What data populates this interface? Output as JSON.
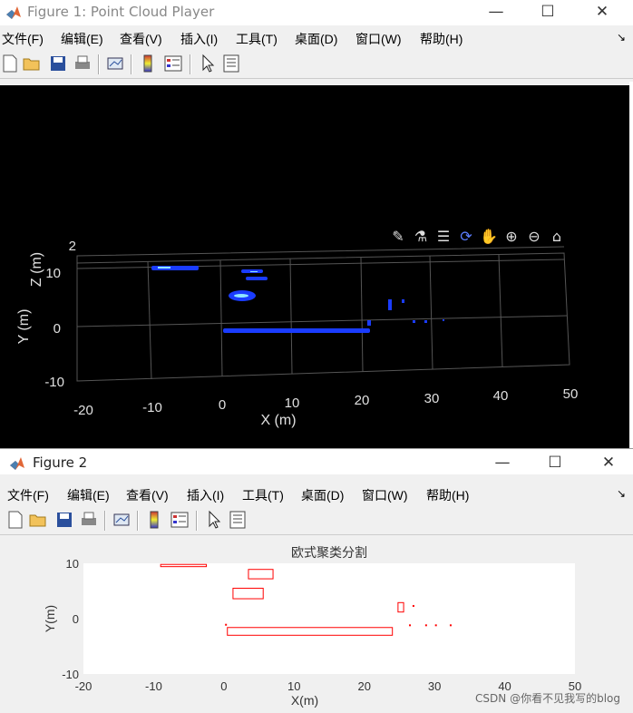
{
  "figure1": {
    "title": "Figure 1: Point Cloud Player",
    "window_controls": {
      "minimize": "—",
      "maximize": "☐",
      "close": "✕"
    },
    "menu": [
      "文件(F)",
      "编辑(E)",
      "查看(V)",
      "插入(I)",
      "工具(T)",
      "桌面(D)",
      "窗口(W)",
      "帮助(H)"
    ],
    "dock_glyph": "↘",
    "plot": {
      "x_ticks": [
        "-20",
        "-10",
        "0",
        "10",
        "20",
        "30",
        "40",
        "50"
      ],
      "y_ticks": [
        "-10",
        "0",
        "10"
      ],
      "z_ticks": [
        "2"
      ],
      "xlabel": "X (m)",
      "ylabel": "Y (m)",
      "zlabel": "Z (m)"
    },
    "axes_toolbar": [
      "brush-icon",
      "datatip-icon",
      "legend-icon",
      "rotate-icon",
      "pan-icon",
      "zoom-in-icon",
      "zoom-out-icon",
      "home-icon"
    ]
  },
  "figure2": {
    "title": "Figure 2",
    "window_controls": {
      "minimize": "—",
      "maximize": "☐",
      "close": "✕"
    },
    "menu": [
      "文件(F)",
      "编辑(E)",
      "查看(V)",
      "插入(I)",
      "工具(T)",
      "桌面(D)",
      "窗口(W)",
      "帮助(H)"
    ],
    "dock_glyph": "↘"
  },
  "chart_data": {
    "type": "scatter",
    "title": "欧式聚类分割",
    "xlabel": "X(m)",
    "ylabel": "Y(m)",
    "xlim": [
      -20,
      50
    ],
    "ylim": [
      -10,
      10
    ],
    "x_ticks": [
      -20,
      -10,
      0,
      10,
      20,
      30,
      40,
      50
    ],
    "y_ticks": [
      -10,
      0,
      10
    ],
    "color": "#ff0000",
    "boxes": [
      {
        "x": [
          -9,
          -2.5
        ],
        "y": [
          9.4,
          9.8
        ]
      },
      {
        "x": [
          3.5,
          7
        ],
        "y": [
          7.2,
          8.9
        ]
      },
      {
        "x": [
          1.3,
          5.6
        ],
        "y": [
          3.6,
          5.5
        ]
      },
      {
        "x": [
          24.8,
          25.6
        ],
        "y": [
          1.2,
          2.9
        ]
      },
      {
        "x": [
          0.5,
          24
        ],
        "y": [
          -3,
          -1.6
        ]
      }
    ],
    "points": [
      {
        "x": 27,
        "y": 2.3
      },
      {
        "x": 0.3,
        "y": -1.1
      },
      {
        "x": 26.5,
        "y": -1.2
      },
      {
        "x": 28.8,
        "y": -1.2
      },
      {
        "x": 30.2,
        "y": -1.2
      },
      {
        "x": 32.3,
        "y": -1.2
      }
    ]
  },
  "footer": {
    "watermark": "CSDN @你看不见我写的blog"
  }
}
